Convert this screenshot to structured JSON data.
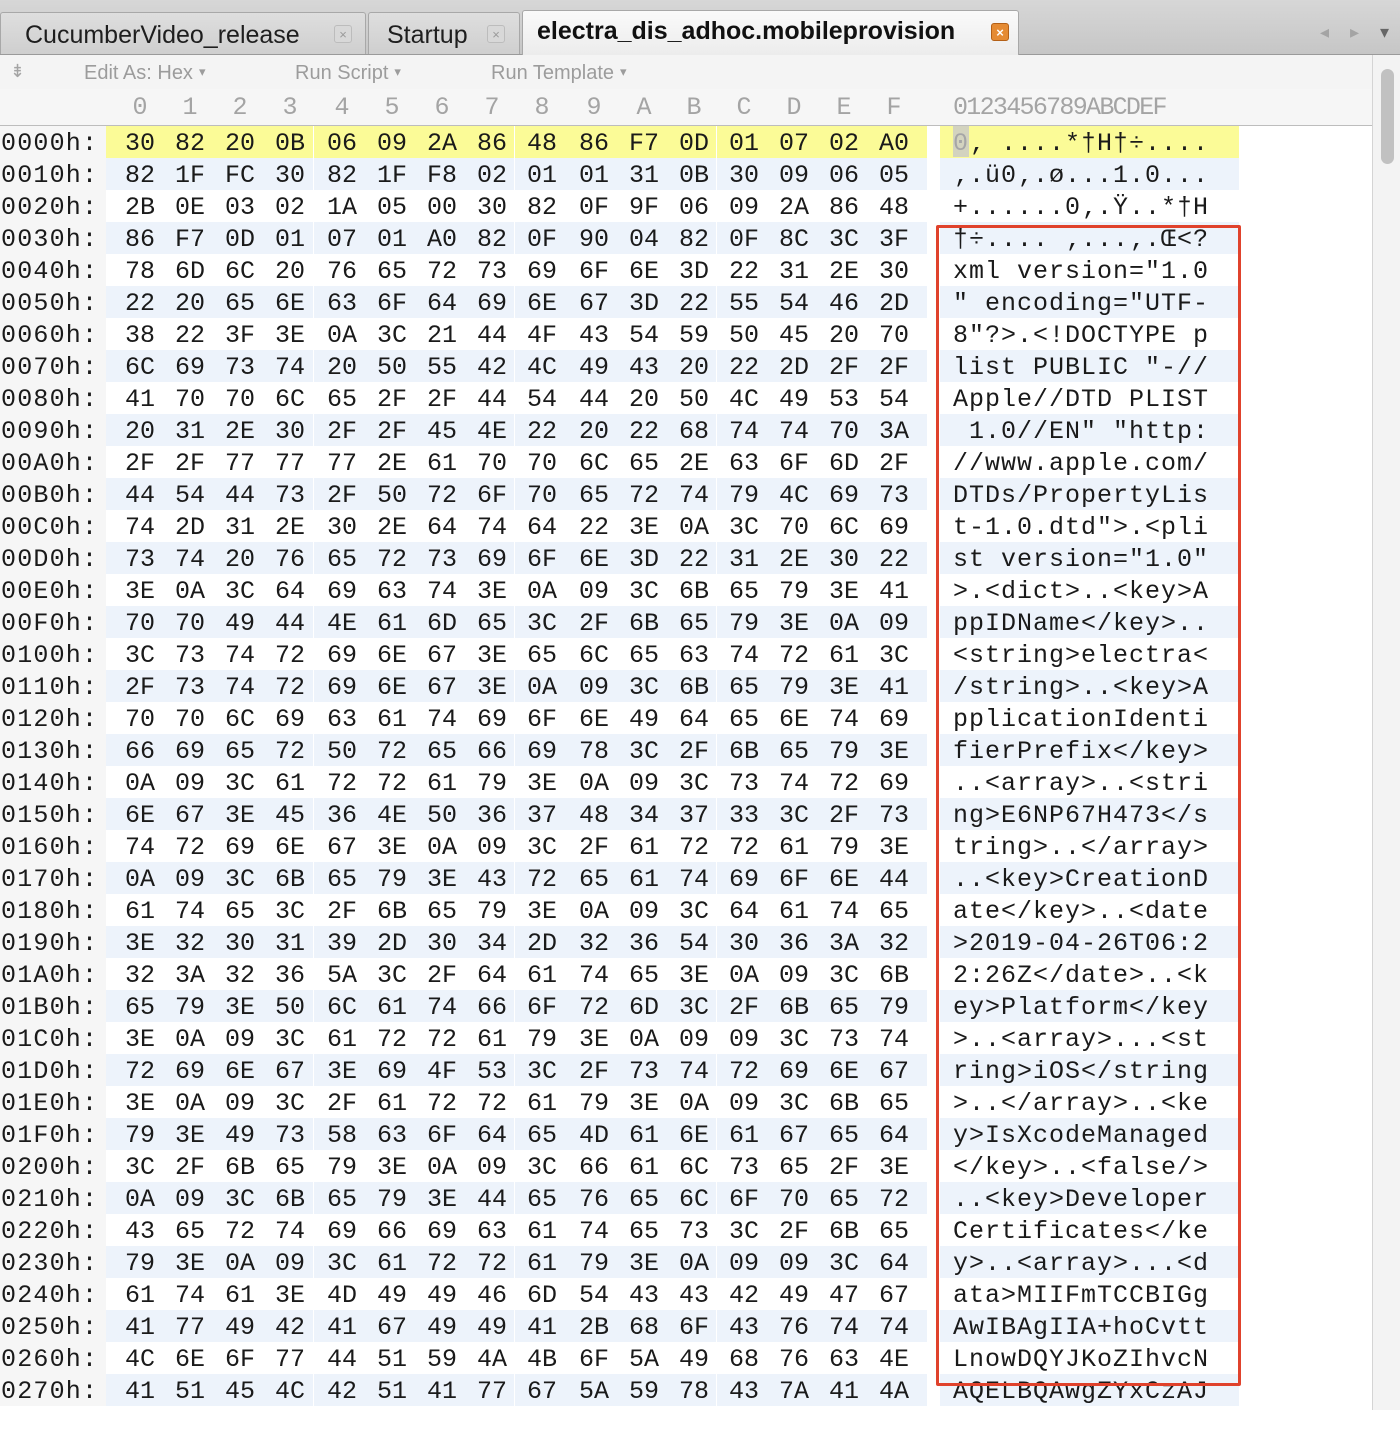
{
  "tabs": [
    {
      "label": "CucumberVideo_release",
      "close": "×"
    },
    {
      "label": "Startup",
      "close": "×"
    },
    {
      "label": "electra_dis_adhoc.mobileprovision",
      "close": "×"
    }
  ],
  "toolbar": {
    "edit_as": "Edit As: Hex",
    "run_script": "Run Script",
    "run_template": "Run Template",
    "caret": "▾"
  },
  "header": {
    "columns": [
      "0",
      "1",
      "2",
      "3",
      "4",
      "5",
      "6",
      "7",
      "8",
      "9",
      "A",
      "B",
      "C",
      "D",
      "E",
      "F"
    ],
    "ascii_header": "0123456789ABCDEF"
  },
  "rows": [
    {
      "addr": "0000h:",
      "hex": [
        "30",
        "82",
        "20",
        "0B",
        "06",
        "09",
        "2A",
        "86",
        "48",
        "86",
        "F7",
        "0D",
        "01",
        "07",
        "02",
        "A0"
      ],
      "ascii": "0‚ ....*†H†÷...."
    },
    {
      "addr": "0010h:",
      "hex": [
        "82",
        "1F",
        "FC",
        "30",
        "82",
        "1F",
        "F8",
        "02",
        "01",
        "01",
        "31",
        "0B",
        "30",
        "09",
        "06",
        "05"
      ],
      "ascii": "‚.ü0‚.ø...1.0..."
    },
    {
      "addr": "0020h:",
      "hex": [
        "2B",
        "0E",
        "03",
        "02",
        "1A",
        "05",
        "00",
        "30",
        "82",
        "0F",
        "9F",
        "06",
        "09",
        "2A",
        "86",
        "48"
      ],
      "ascii": "+......0‚.Ÿ..*†H"
    },
    {
      "addr": "0030h:",
      "hex": [
        "86",
        "F7",
        "0D",
        "01",
        "07",
        "01",
        "A0",
        "82",
        "0F",
        "90",
        "04",
        "82",
        "0F",
        "8C",
        "3C",
        "3F"
      ],
      "ascii": "†÷.... ‚...‚.Œ<?"
    },
    {
      "addr": "0040h:",
      "hex": [
        "78",
        "6D",
        "6C",
        "20",
        "76",
        "65",
        "72",
        "73",
        "69",
        "6F",
        "6E",
        "3D",
        "22",
        "31",
        "2E",
        "30"
      ],
      "ascii": "xml version=\"1.0"
    },
    {
      "addr": "0050h:",
      "hex": [
        "22",
        "20",
        "65",
        "6E",
        "63",
        "6F",
        "64",
        "69",
        "6E",
        "67",
        "3D",
        "22",
        "55",
        "54",
        "46",
        "2D"
      ],
      "ascii": "\" encoding=\"UTF-"
    },
    {
      "addr": "0060h:",
      "hex": [
        "38",
        "22",
        "3F",
        "3E",
        "0A",
        "3C",
        "21",
        "44",
        "4F",
        "43",
        "54",
        "59",
        "50",
        "45",
        "20",
        "70"
      ],
      "ascii": "8\"?>.<!DOCTYPE p"
    },
    {
      "addr": "0070h:",
      "hex": [
        "6C",
        "69",
        "73",
        "74",
        "20",
        "50",
        "55",
        "42",
        "4C",
        "49",
        "43",
        "20",
        "22",
        "2D",
        "2F",
        "2F"
      ],
      "ascii": "list PUBLIC \"-//"
    },
    {
      "addr": "0080h:",
      "hex": [
        "41",
        "70",
        "70",
        "6C",
        "65",
        "2F",
        "2F",
        "44",
        "54",
        "44",
        "20",
        "50",
        "4C",
        "49",
        "53",
        "54"
      ],
      "ascii": "Apple//DTD PLIST"
    },
    {
      "addr": "0090h:",
      "hex": [
        "20",
        "31",
        "2E",
        "30",
        "2F",
        "2F",
        "45",
        "4E",
        "22",
        "20",
        "22",
        "68",
        "74",
        "74",
        "70",
        "3A"
      ],
      "ascii": " 1.0//EN\" \"http:"
    },
    {
      "addr": "00A0h:",
      "hex": [
        "2F",
        "2F",
        "77",
        "77",
        "77",
        "2E",
        "61",
        "70",
        "70",
        "6C",
        "65",
        "2E",
        "63",
        "6F",
        "6D",
        "2F"
      ],
      "ascii": "//www.apple.com/"
    },
    {
      "addr": "00B0h:",
      "hex": [
        "44",
        "54",
        "44",
        "73",
        "2F",
        "50",
        "72",
        "6F",
        "70",
        "65",
        "72",
        "74",
        "79",
        "4C",
        "69",
        "73"
      ],
      "ascii": "DTDs/PropertyLis"
    },
    {
      "addr": "00C0h:",
      "hex": [
        "74",
        "2D",
        "31",
        "2E",
        "30",
        "2E",
        "64",
        "74",
        "64",
        "22",
        "3E",
        "0A",
        "3C",
        "70",
        "6C",
        "69"
      ],
      "ascii": "t-1.0.dtd\">.<pli"
    },
    {
      "addr": "00D0h:",
      "hex": [
        "73",
        "74",
        "20",
        "76",
        "65",
        "72",
        "73",
        "69",
        "6F",
        "6E",
        "3D",
        "22",
        "31",
        "2E",
        "30",
        "22"
      ],
      "ascii": "st version=\"1.0\""
    },
    {
      "addr": "00E0h:",
      "hex": [
        "3E",
        "0A",
        "3C",
        "64",
        "69",
        "63",
        "74",
        "3E",
        "0A",
        "09",
        "3C",
        "6B",
        "65",
        "79",
        "3E",
        "41"
      ],
      "ascii": ">.<dict>..<key>A"
    },
    {
      "addr": "00F0h:",
      "hex": [
        "70",
        "70",
        "49",
        "44",
        "4E",
        "61",
        "6D",
        "65",
        "3C",
        "2F",
        "6B",
        "65",
        "79",
        "3E",
        "0A",
        "09"
      ],
      "ascii": "ppIDName</key>.."
    },
    {
      "addr": "0100h:",
      "hex": [
        "3C",
        "73",
        "74",
        "72",
        "69",
        "6E",
        "67",
        "3E",
        "65",
        "6C",
        "65",
        "63",
        "74",
        "72",
        "61",
        "3C"
      ],
      "ascii": "<string>electra<"
    },
    {
      "addr": "0110h:",
      "hex": [
        "2F",
        "73",
        "74",
        "72",
        "69",
        "6E",
        "67",
        "3E",
        "0A",
        "09",
        "3C",
        "6B",
        "65",
        "79",
        "3E",
        "41"
      ],
      "ascii": "/string>..<key>A"
    },
    {
      "addr": "0120h:",
      "hex": [
        "70",
        "70",
        "6C",
        "69",
        "63",
        "61",
        "74",
        "69",
        "6F",
        "6E",
        "49",
        "64",
        "65",
        "6E",
        "74",
        "69"
      ],
      "ascii": "pplicationIdenti"
    },
    {
      "addr": "0130h:",
      "hex": [
        "66",
        "69",
        "65",
        "72",
        "50",
        "72",
        "65",
        "66",
        "69",
        "78",
        "3C",
        "2F",
        "6B",
        "65",
        "79",
        "3E"
      ],
      "ascii": "fierPrefix</key>"
    },
    {
      "addr": "0140h:",
      "hex": [
        "0A",
        "09",
        "3C",
        "61",
        "72",
        "72",
        "61",
        "79",
        "3E",
        "0A",
        "09",
        "3C",
        "73",
        "74",
        "72",
        "69"
      ],
      "ascii": "..<array>..<stri"
    },
    {
      "addr": "0150h:",
      "hex": [
        "6E",
        "67",
        "3E",
        "45",
        "36",
        "4E",
        "50",
        "36",
        "37",
        "48",
        "34",
        "37",
        "33",
        "3C",
        "2F",
        "73"
      ],
      "ascii": "ng>E6NP67H473</s"
    },
    {
      "addr": "0160h:",
      "hex": [
        "74",
        "72",
        "69",
        "6E",
        "67",
        "3E",
        "0A",
        "09",
        "3C",
        "2F",
        "61",
        "72",
        "72",
        "61",
        "79",
        "3E"
      ],
      "ascii": "tring>..</array>"
    },
    {
      "addr": "0170h:",
      "hex": [
        "0A",
        "09",
        "3C",
        "6B",
        "65",
        "79",
        "3E",
        "43",
        "72",
        "65",
        "61",
        "74",
        "69",
        "6F",
        "6E",
        "44"
      ],
      "ascii": "..<key>CreationD"
    },
    {
      "addr": "0180h:",
      "hex": [
        "61",
        "74",
        "65",
        "3C",
        "2F",
        "6B",
        "65",
        "79",
        "3E",
        "0A",
        "09",
        "3C",
        "64",
        "61",
        "74",
        "65"
      ],
      "ascii": "ate</key>..<date"
    },
    {
      "addr": "0190h:",
      "hex": [
        "3E",
        "32",
        "30",
        "31",
        "39",
        "2D",
        "30",
        "34",
        "2D",
        "32",
        "36",
        "54",
        "30",
        "36",
        "3A",
        "32"
      ],
      "ascii": ">2019-04-26T06:2"
    },
    {
      "addr": "01A0h:",
      "hex": [
        "32",
        "3A",
        "32",
        "36",
        "5A",
        "3C",
        "2F",
        "64",
        "61",
        "74",
        "65",
        "3E",
        "0A",
        "09",
        "3C",
        "6B"
      ],
      "ascii": "2:26Z</date>..<k"
    },
    {
      "addr": "01B0h:",
      "hex": [
        "65",
        "79",
        "3E",
        "50",
        "6C",
        "61",
        "74",
        "66",
        "6F",
        "72",
        "6D",
        "3C",
        "2F",
        "6B",
        "65",
        "79"
      ],
      "ascii": "ey>Platform</key"
    },
    {
      "addr": "01C0h:",
      "hex": [
        "3E",
        "0A",
        "09",
        "3C",
        "61",
        "72",
        "72",
        "61",
        "79",
        "3E",
        "0A",
        "09",
        "09",
        "3C",
        "73",
        "74"
      ],
      "ascii": ">..<array>...<st"
    },
    {
      "addr": "01D0h:",
      "hex": [
        "72",
        "69",
        "6E",
        "67",
        "3E",
        "69",
        "4F",
        "53",
        "3C",
        "2F",
        "73",
        "74",
        "72",
        "69",
        "6E",
        "67"
      ],
      "ascii": "ring>iOS</string"
    },
    {
      "addr": "01E0h:",
      "hex": [
        "3E",
        "0A",
        "09",
        "3C",
        "2F",
        "61",
        "72",
        "72",
        "61",
        "79",
        "3E",
        "0A",
        "09",
        "3C",
        "6B",
        "65"
      ],
      "ascii": ">..</array>..<ke"
    },
    {
      "addr": "01F0h:",
      "hex": [
        "79",
        "3E",
        "49",
        "73",
        "58",
        "63",
        "6F",
        "64",
        "65",
        "4D",
        "61",
        "6E",
        "61",
        "67",
        "65",
        "64"
      ],
      "ascii": "y>IsXcodeManaged"
    },
    {
      "addr": "0200h:",
      "hex": [
        "3C",
        "2F",
        "6B",
        "65",
        "79",
        "3E",
        "0A",
        "09",
        "3C",
        "66",
        "61",
        "6C",
        "73",
        "65",
        "2F",
        "3E"
      ],
      "ascii": "</key>..<false/>"
    },
    {
      "addr": "0210h:",
      "hex": [
        "0A",
        "09",
        "3C",
        "6B",
        "65",
        "79",
        "3E",
        "44",
        "65",
        "76",
        "65",
        "6C",
        "6F",
        "70",
        "65",
        "72"
      ],
      "ascii": "..<key>Developer"
    },
    {
      "addr": "0220h:",
      "hex": [
        "43",
        "65",
        "72",
        "74",
        "69",
        "66",
        "69",
        "63",
        "61",
        "74",
        "65",
        "73",
        "3C",
        "2F",
        "6B",
        "65"
      ],
      "ascii": "Certificates</ke"
    },
    {
      "addr": "0230h:",
      "hex": [
        "79",
        "3E",
        "0A",
        "09",
        "3C",
        "61",
        "72",
        "72",
        "61",
        "79",
        "3E",
        "0A",
        "09",
        "09",
        "3C",
        "64"
      ],
      "ascii": "y>..<array>...<d"
    },
    {
      "addr": "0240h:",
      "hex": [
        "61",
        "74",
        "61",
        "3E",
        "4D",
        "49",
        "49",
        "46",
        "6D",
        "54",
        "43",
        "43",
        "42",
        "49",
        "47",
        "67"
      ],
      "ascii": "ata>MIIFmTCCBIGg"
    },
    {
      "addr": "0250h:",
      "hex": [
        "41",
        "77",
        "49",
        "42",
        "41",
        "67",
        "49",
        "49",
        "41",
        "2B",
        "68",
        "6F",
        "43",
        "76",
        "74",
        "74"
      ],
      "ascii": "AwIBAgIIA+hoCvtt"
    },
    {
      "addr": "0260h:",
      "hex": [
        "4C",
        "6E",
        "6F",
        "77",
        "44",
        "51",
        "59",
        "4A",
        "4B",
        "6F",
        "5A",
        "49",
        "68",
        "76",
        "63",
        "4E"
      ],
      "ascii": "LnowDQYJKoZIhvcN"
    },
    {
      "addr": "0270h:",
      "hex": [
        "41",
        "51",
        "45",
        "4C",
        "42",
        "51",
        "41",
        "77",
        "67",
        "5A",
        "59",
        "78",
        "43",
        "7A",
        "41",
        "4A"
      ],
      "ascii": "AQELBQAwgZYxCzAJ"
    }
  ],
  "highlighted_row": 0,
  "colors": {
    "highlight": "#fbfb97",
    "alt_row": "#edf3fb",
    "selection_outline": "#e0422c",
    "active_tab_close": "#e58b34"
  }
}
